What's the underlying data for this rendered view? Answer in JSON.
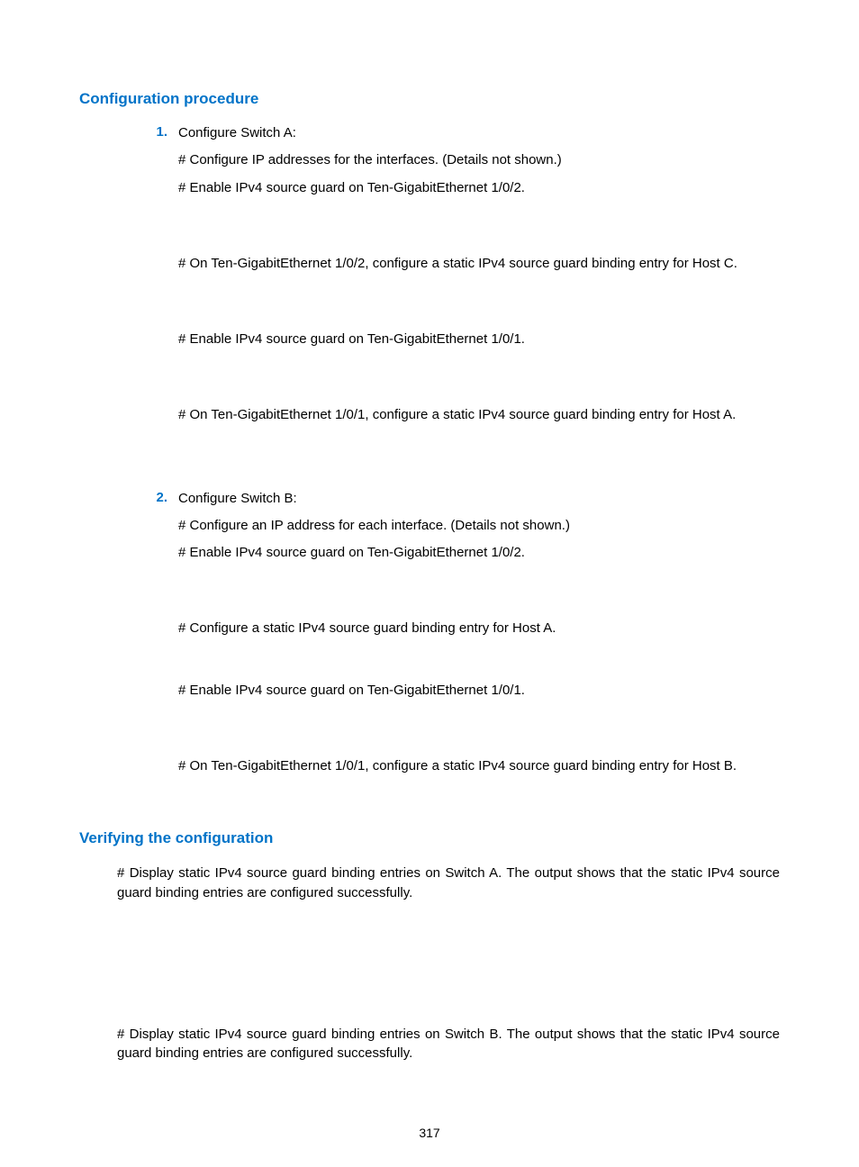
{
  "heading1": "Configuration procedure",
  "step1": {
    "num": "1.",
    "title": "Configure Switch A:",
    "l1": "# Configure IP addresses for the interfaces. (Details not shown.)",
    "l2": "# Enable IPv4 source guard on Ten-GigabitEthernet 1/0/2.",
    "l3": "# On Ten-GigabitEthernet 1/0/2, configure a static IPv4 source guard binding entry for Host C.",
    "l4": "# Enable IPv4 source guard on Ten-GigabitEthernet 1/0/1.",
    "l5": "# On Ten-GigabitEthernet 1/0/1, configure a static IPv4 source guard binding entry for Host A."
  },
  "step2": {
    "num": "2.",
    "title": "Configure Switch B:",
    "l1": "# Configure an IP address for each interface. (Details not shown.)",
    "l2": "# Enable IPv4 source guard on Ten-GigabitEthernet 1/0/2.",
    "l3": "# Configure a static IPv4 source guard binding entry for Host A.",
    "l4": "# Enable IPv4 source guard on Ten-GigabitEthernet 1/0/1.",
    "l5": "# On Ten-GigabitEthernet 1/0/1, configure a static IPv4 source guard binding entry for Host B."
  },
  "heading2": "Verifying the configuration",
  "verify": {
    "p1": "# Display static IPv4 source guard binding entries on Switch A. The output shows that the static IPv4 source guard binding entries are configured successfully.",
    "p2": "# Display static IPv4 source guard binding entries on Switch B. The output shows that the static IPv4 source guard binding entries are configured successfully."
  },
  "pageNumber": "317"
}
